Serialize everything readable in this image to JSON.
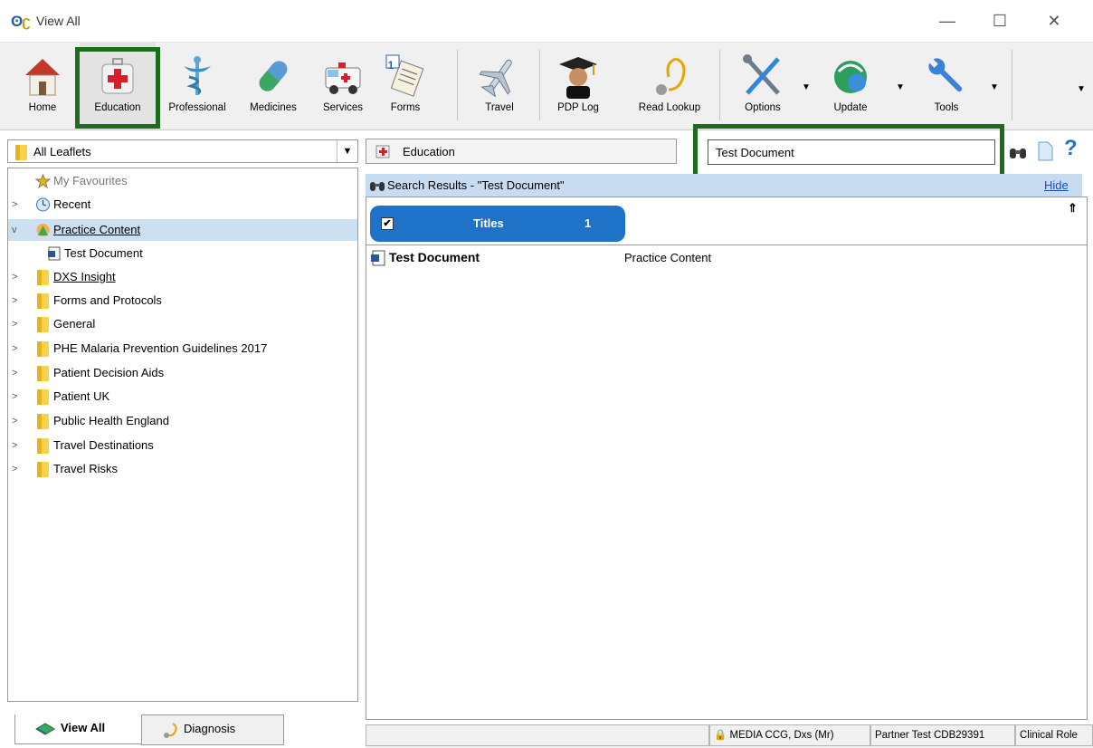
{
  "window": {
    "app_logo": "DXS",
    "title": "View All",
    "controls": [
      "minimize-icon",
      "maximize-icon",
      "close-icon"
    ]
  },
  "toolbar": {
    "items": [
      {
        "label": "Home",
        "icon": "home-icon"
      },
      {
        "label": "Education",
        "icon": "medical-kit-icon",
        "active": true
      },
      {
        "label": "Professional",
        "icon": "caduceus-icon"
      },
      {
        "label": "Medicines",
        "icon": "pill-icon"
      },
      {
        "label": "Services",
        "icon": "ambulance-icon"
      },
      {
        "label": "Forms",
        "icon": "forms-icon",
        "badge": "1"
      },
      {
        "label": "Travel",
        "icon": "airplane-icon"
      },
      {
        "label": "PDP Log",
        "icon": "graduate-icon"
      },
      {
        "label": "Read Lookup",
        "icon": "stethoscope-icon"
      },
      {
        "label": "Options",
        "icon": "tools-options-icon",
        "dropdown": true
      },
      {
        "label": "Update",
        "icon": "update-globe-icon",
        "dropdown": true
      },
      {
        "label": "Tools",
        "icon": "wrench-icon",
        "dropdown": true
      }
    ],
    "overflow_icon": "chevron-down-icon"
  },
  "left_panel": {
    "filter_selected": "All Leaflets",
    "tree": [
      {
        "label": "My Favourites",
        "icon": "favourites-star-icon",
        "expandable": false,
        "muted": true
      },
      {
        "label": "Recent",
        "icon": "recent-clock-icon",
        "expandable": true
      },
      {
        "label": "Practice Content",
        "icon": "practice-content-icon",
        "expandable": true,
        "expanded": true,
        "selected": true,
        "link": true
      },
      {
        "label": "Test Document",
        "icon": "word-document-icon",
        "child": true
      },
      {
        "label": "DXS Insight",
        "icon": "folder-icon",
        "expandable": true,
        "link": true
      },
      {
        "label": "Forms and Protocols",
        "icon": "folder-icon",
        "expandable": true
      },
      {
        "label": "General",
        "icon": "folder-icon",
        "expandable": true
      },
      {
        "label": "PHE Malaria Prevention Guidelines 2017",
        "icon": "folder-icon",
        "expandable": true
      },
      {
        "label": "Patient Decision Aids",
        "icon": "folder-icon",
        "expandable": true
      },
      {
        "label": "Patient UK",
        "icon": "folder-icon",
        "expandable": true
      },
      {
        "label": "Public Health England",
        "icon": "folder-icon",
        "expandable": true
      },
      {
        "label": "Travel Destinations",
        "icon": "folder-icon",
        "expandable": true
      },
      {
        "label": "Travel Risks",
        "icon": "folder-icon",
        "expandable": true
      }
    ],
    "bottom_tabs": [
      {
        "label": "View All",
        "icon": "book-icon",
        "active": true
      },
      {
        "label": "Diagnosis",
        "icon": "stethoscope-icon"
      }
    ]
  },
  "right_panel": {
    "breadcrumb": "Education",
    "search_value": "Test Document",
    "results_header": "Search Results - \"Test Document\"",
    "hide_link": "Hide",
    "titles_tab": {
      "label": "Titles",
      "count": "1",
      "checked": true
    },
    "results": [
      {
        "title": "Test Document",
        "category": "Practice Content",
        "icon": "word-document-icon"
      }
    ]
  },
  "status_bar": {
    "user": "MEDIA CCG, Dxs (Mr)",
    "partner": "Partner Test CDB29391",
    "role": "Clinical Role"
  },
  "colors": {
    "highlight_border": "#1d6b1d",
    "titles_pill": "#1e73c8",
    "results_header_bg": "#c7dcf1",
    "selection_bg": "#cde0f0"
  }
}
